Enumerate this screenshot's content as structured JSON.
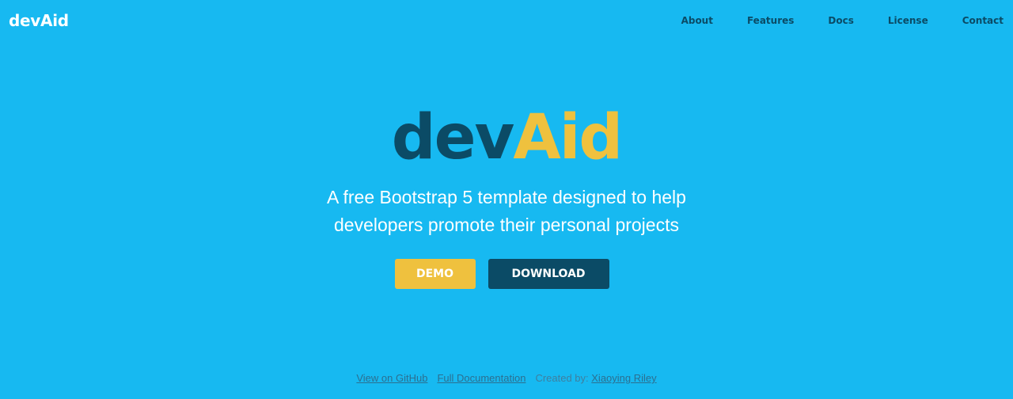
{
  "header": {
    "brand": "devAid",
    "nav": [
      {
        "label": "About"
      },
      {
        "label": "Features"
      },
      {
        "label": "Docs"
      },
      {
        "label": "License"
      },
      {
        "label": "Contact"
      }
    ]
  },
  "hero": {
    "title_part1": "dev",
    "title_part2": "Aid",
    "subtitle": "A free Bootstrap 5 template designed to help developers promote their personal projects",
    "demo_label": "DEMO",
    "download_label": "DOWNLOAD"
  },
  "footer": {
    "github_link": "View on GitHub",
    "docs_link": "Full Documentation",
    "created_by_label": "Created by:",
    "author_link": "Xiaoying Riley"
  },
  "colors": {
    "background": "#17b9f1",
    "dark": "#0b4b66",
    "accent": "#efc13e"
  }
}
